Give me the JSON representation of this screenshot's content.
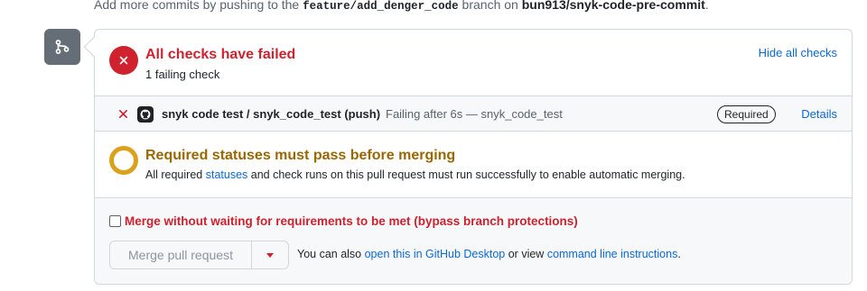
{
  "top_note": {
    "prefix": "Add more commits by pushing to the",
    "branch": "feature/add_denger_code",
    "middle": "branch on",
    "repo": "bun913/snyk-code-pre-commit",
    "suffix": "."
  },
  "checks_header": {
    "title": "All checks have failed",
    "subtitle": "1 failing check",
    "hide_label": "Hide all checks",
    "status_color": "#cf222e"
  },
  "check_row": {
    "name": "snyk code test / snyk_code_test (push)",
    "description": "Failing after 6s — snyk_code_test",
    "badge": "Required",
    "details_label": "Details"
  },
  "required_status": {
    "title": "Required statuses must pass before merging",
    "desc_prefix": "All required",
    "desc_link": "statuses",
    "desc_suffix": "and check runs on this pull request must run successfully to enable automatic merging.",
    "status_color": "#dba11c"
  },
  "merge": {
    "bypass_label": "Merge without waiting for requirements to be met (bypass branch protections)",
    "bypass_checked": false,
    "button_label": "Merge pull request",
    "help_prefix": "You can also",
    "help_link_desktop": "open this in GitHub Desktop",
    "help_middle": "or view",
    "help_link_cli": "command line instructions",
    "help_suffix": "."
  },
  "icons": {
    "timeline": "git-branch-icon",
    "fail": "x-circle-icon",
    "check_fail": "x-icon",
    "check_app": "github-logo-icon",
    "pending": "pending-ring-icon",
    "dropdown": "triangle-down-icon"
  }
}
